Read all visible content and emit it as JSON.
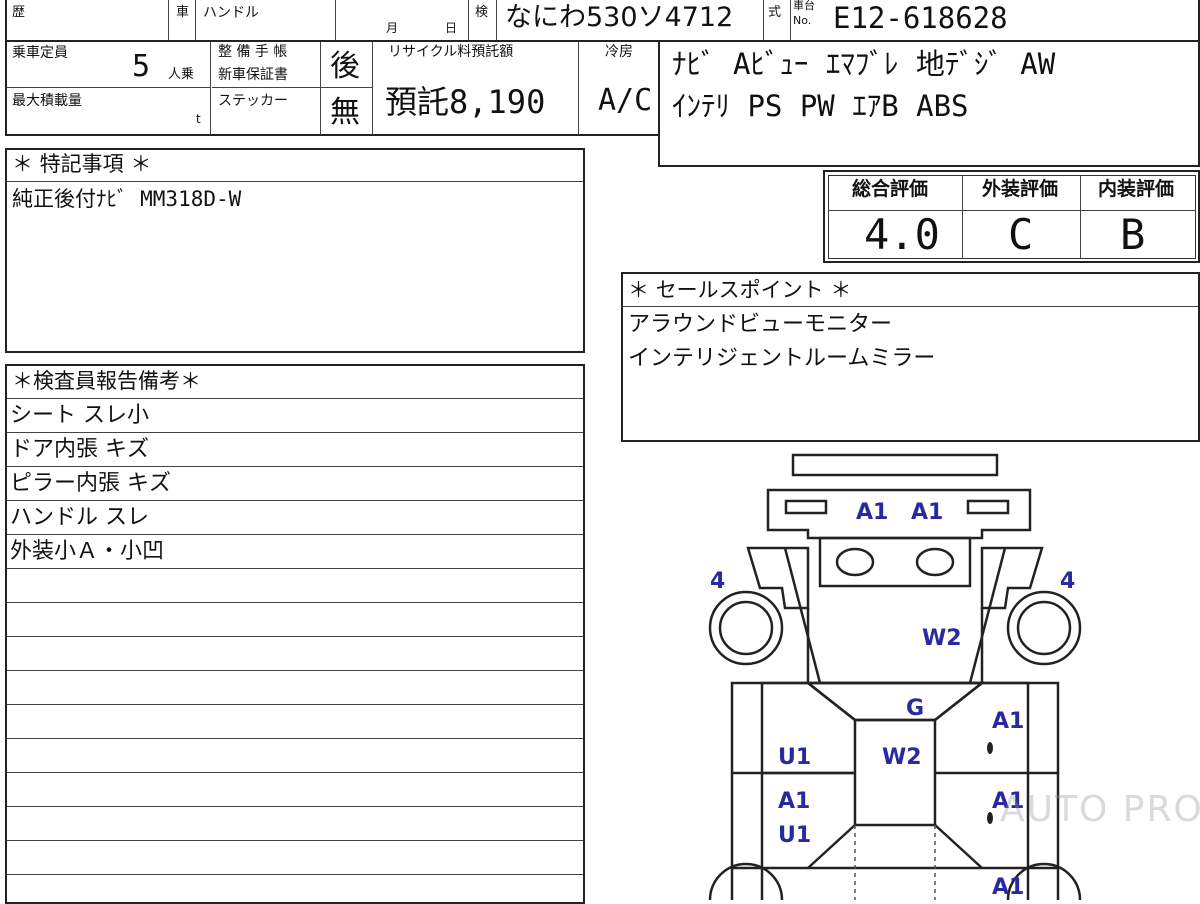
{
  "header": {
    "history_label": "歴",
    "car_label": "車",
    "handle_label": "ハンドル",
    "month_label": "月",
    "day_label": "日",
    "inspection_label": "検",
    "plate_number": "なにわ530ソ4712",
    "type_label": "式",
    "chassis_label_top": "車台",
    "chassis_label_no": "No.",
    "chassis_number": "E12-618628"
  },
  "specs": {
    "capacity_label": "乗車定員",
    "capacity_value": "5",
    "capacity_unit": "人乗",
    "max_load_label": "最大積載量",
    "max_load_unit": "t",
    "maintenance_label_1": "整 備 手 帳",
    "maintenance_label_2": "新車保証書",
    "maintenance_value": "後",
    "sticker_label": "ステッカー",
    "sticker_value": "無",
    "recycle_label": "リサイクル料預託額",
    "recycle_value": "預託8,190",
    "cooler_label": "冷房",
    "cooler_value": "A/C"
  },
  "equipment": {
    "line1": "ﾅﾋﾞ Aﾋﾞｭｰ ｴﾏﾌﾞﾚ 地ﾃﾞｼﾞ AW",
    "line2": "ｲﾝﾃﾘ PS PW ｴｱB ABS"
  },
  "ratings": {
    "overall_label": "総合評価",
    "overall_value": "4.0",
    "exterior_label": "外装評価",
    "exterior_value": "C",
    "interior_label": "内装評価",
    "interior_value": "B"
  },
  "special_notes": {
    "title": "＊ 特記事項 ＊",
    "lines": [
      "純正後付ﾅﾋﾞ MM318D-W"
    ]
  },
  "sales_points": {
    "title": "＊ セールスポイント ＊",
    "lines": [
      "アラウンドビューモニター",
      "インテリジェントルームミラー"
    ]
  },
  "inspector_report": {
    "title": "＊検査員報告備考＊",
    "rows": [
      "シート スレ小",
      "ドア内張 キズ",
      "ピラー内張 キズ",
      "ハンドル スレ",
      "外装小Ａ・小凹"
    ]
  },
  "damage_map": {
    "marks": {
      "front_bumper_left": "A1",
      "front_bumper_right": "A1",
      "front_left_wheel": "4",
      "front_right_wheel": "4",
      "windshield": "W2",
      "hood": "G",
      "roof_glass": "W2",
      "right_front_door": "A1",
      "left_front_door": "U1",
      "left_rear_door_1": "A1",
      "left_rear_door_2": "U1",
      "right_rear_door": "A1",
      "right_rear_fender": "A1"
    }
  },
  "watermark": "AUTO PRO"
}
